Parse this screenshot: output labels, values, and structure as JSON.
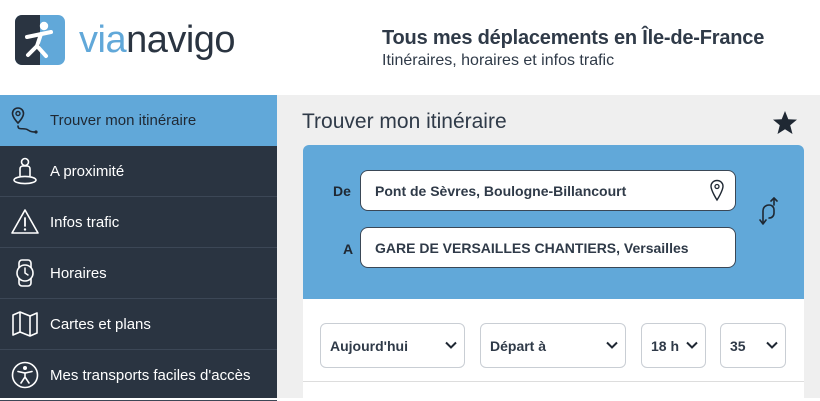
{
  "brand": {
    "via": "via",
    "navigo": "navigo"
  },
  "header": {
    "tagline_title": "Tous mes déplacements en Île-de-France",
    "tagline_subtitle": "Itinéraires, horaires et infos trafic"
  },
  "sidebar": {
    "items": [
      {
        "label": "Trouver mon itinéraire",
        "icon": "route-pin-icon",
        "active": true
      },
      {
        "label": "A proximité",
        "icon": "nearby-person-icon",
        "active": false
      },
      {
        "label": "Infos trafic",
        "icon": "warning-icon",
        "active": false
      },
      {
        "label": "Horaires",
        "icon": "watch-icon",
        "active": false
      },
      {
        "label": "Cartes et plans",
        "icon": "map-icon",
        "active": false
      },
      {
        "label": "Mes transports faciles d'accès",
        "icon": "accessibility-icon",
        "active": false
      }
    ]
  },
  "main": {
    "title": "Trouver mon itinéraire",
    "from_label": "De",
    "from_value": "Pont de Sèvres, Boulogne-Billancourt",
    "to_label": "A",
    "to_value": "GARE DE VERSAILLES CHANTIERS, Versailles",
    "date_select": "Aujourd'hui",
    "mode_select": "Départ à",
    "hour_select": "18 h",
    "minute_select": "35"
  },
  "colors": {
    "accent": "#61A8D9",
    "dark": "#2A3441",
    "panel_bg": "#EFEFEF"
  }
}
